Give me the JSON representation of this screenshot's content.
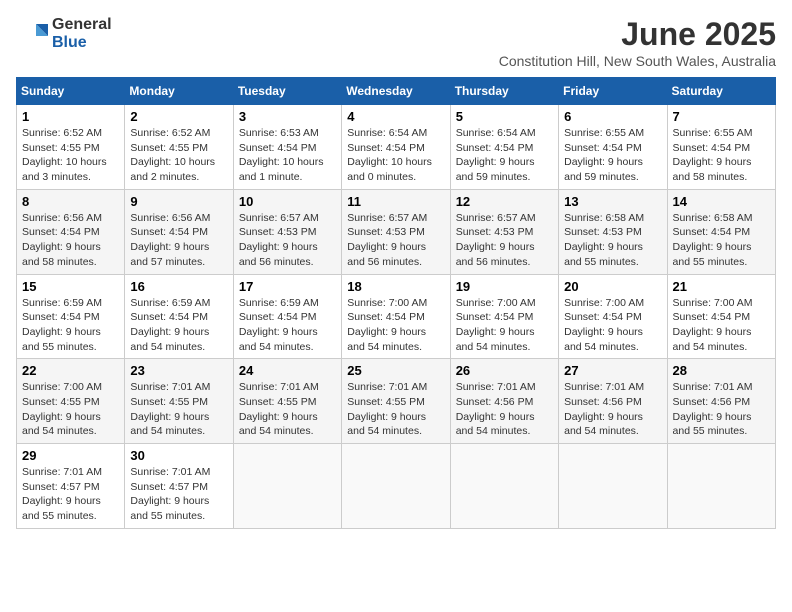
{
  "logo": {
    "general": "General",
    "blue": "Blue"
  },
  "title": "June 2025",
  "location": "Constitution Hill, New South Wales, Australia",
  "days_of_week": [
    "Sunday",
    "Monday",
    "Tuesday",
    "Wednesday",
    "Thursday",
    "Friday",
    "Saturday"
  ],
  "weeks": [
    [
      {
        "day": "1",
        "lines": [
          "Sunrise: 6:52 AM",
          "Sunset: 4:55 PM",
          "Daylight: 10 hours",
          "and 3 minutes."
        ]
      },
      {
        "day": "2",
        "lines": [
          "Sunrise: 6:52 AM",
          "Sunset: 4:55 PM",
          "Daylight: 10 hours",
          "and 2 minutes."
        ]
      },
      {
        "day": "3",
        "lines": [
          "Sunrise: 6:53 AM",
          "Sunset: 4:54 PM",
          "Daylight: 10 hours",
          "and 1 minute."
        ]
      },
      {
        "day": "4",
        "lines": [
          "Sunrise: 6:54 AM",
          "Sunset: 4:54 PM",
          "Daylight: 10 hours",
          "and 0 minutes."
        ]
      },
      {
        "day": "5",
        "lines": [
          "Sunrise: 6:54 AM",
          "Sunset: 4:54 PM",
          "Daylight: 9 hours",
          "and 59 minutes."
        ]
      },
      {
        "day": "6",
        "lines": [
          "Sunrise: 6:55 AM",
          "Sunset: 4:54 PM",
          "Daylight: 9 hours",
          "and 59 minutes."
        ]
      },
      {
        "day": "7",
        "lines": [
          "Sunrise: 6:55 AM",
          "Sunset: 4:54 PM",
          "Daylight: 9 hours",
          "and 58 minutes."
        ]
      }
    ],
    [
      {
        "day": "8",
        "lines": [
          "Sunrise: 6:56 AM",
          "Sunset: 4:54 PM",
          "Daylight: 9 hours",
          "and 58 minutes."
        ]
      },
      {
        "day": "9",
        "lines": [
          "Sunrise: 6:56 AM",
          "Sunset: 4:54 PM",
          "Daylight: 9 hours",
          "and 57 minutes."
        ]
      },
      {
        "day": "10",
        "lines": [
          "Sunrise: 6:57 AM",
          "Sunset: 4:53 PM",
          "Daylight: 9 hours",
          "and 56 minutes."
        ]
      },
      {
        "day": "11",
        "lines": [
          "Sunrise: 6:57 AM",
          "Sunset: 4:53 PM",
          "Daylight: 9 hours",
          "and 56 minutes."
        ]
      },
      {
        "day": "12",
        "lines": [
          "Sunrise: 6:57 AM",
          "Sunset: 4:53 PM",
          "Daylight: 9 hours",
          "and 56 minutes."
        ]
      },
      {
        "day": "13",
        "lines": [
          "Sunrise: 6:58 AM",
          "Sunset: 4:53 PM",
          "Daylight: 9 hours",
          "and 55 minutes."
        ]
      },
      {
        "day": "14",
        "lines": [
          "Sunrise: 6:58 AM",
          "Sunset: 4:54 PM",
          "Daylight: 9 hours",
          "and 55 minutes."
        ]
      }
    ],
    [
      {
        "day": "15",
        "lines": [
          "Sunrise: 6:59 AM",
          "Sunset: 4:54 PM",
          "Daylight: 9 hours",
          "and 55 minutes."
        ]
      },
      {
        "day": "16",
        "lines": [
          "Sunrise: 6:59 AM",
          "Sunset: 4:54 PM",
          "Daylight: 9 hours",
          "and 54 minutes."
        ]
      },
      {
        "day": "17",
        "lines": [
          "Sunrise: 6:59 AM",
          "Sunset: 4:54 PM",
          "Daylight: 9 hours",
          "and 54 minutes."
        ]
      },
      {
        "day": "18",
        "lines": [
          "Sunrise: 7:00 AM",
          "Sunset: 4:54 PM",
          "Daylight: 9 hours",
          "and 54 minutes."
        ]
      },
      {
        "day": "19",
        "lines": [
          "Sunrise: 7:00 AM",
          "Sunset: 4:54 PM",
          "Daylight: 9 hours",
          "and 54 minutes."
        ]
      },
      {
        "day": "20",
        "lines": [
          "Sunrise: 7:00 AM",
          "Sunset: 4:54 PM",
          "Daylight: 9 hours",
          "and 54 minutes."
        ]
      },
      {
        "day": "21",
        "lines": [
          "Sunrise: 7:00 AM",
          "Sunset: 4:54 PM",
          "Daylight: 9 hours",
          "and 54 minutes."
        ]
      }
    ],
    [
      {
        "day": "22",
        "lines": [
          "Sunrise: 7:00 AM",
          "Sunset: 4:55 PM",
          "Daylight: 9 hours",
          "and 54 minutes."
        ]
      },
      {
        "day": "23",
        "lines": [
          "Sunrise: 7:01 AM",
          "Sunset: 4:55 PM",
          "Daylight: 9 hours",
          "and 54 minutes."
        ]
      },
      {
        "day": "24",
        "lines": [
          "Sunrise: 7:01 AM",
          "Sunset: 4:55 PM",
          "Daylight: 9 hours",
          "and 54 minutes."
        ]
      },
      {
        "day": "25",
        "lines": [
          "Sunrise: 7:01 AM",
          "Sunset: 4:55 PM",
          "Daylight: 9 hours",
          "and 54 minutes."
        ]
      },
      {
        "day": "26",
        "lines": [
          "Sunrise: 7:01 AM",
          "Sunset: 4:56 PM",
          "Daylight: 9 hours",
          "and 54 minutes."
        ]
      },
      {
        "day": "27",
        "lines": [
          "Sunrise: 7:01 AM",
          "Sunset: 4:56 PM",
          "Daylight: 9 hours",
          "and 54 minutes."
        ]
      },
      {
        "day": "28",
        "lines": [
          "Sunrise: 7:01 AM",
          "Sunset: 4:56 PM",
          "Daylight: 9 hours",
          "and 55 minutes."
        ]
      }
    ],
    [
      {
        "day": "29",
        "lines": [
          "Sunrise: 7:01 AM",
          "Sunset: 4:57 PM",
          "Daylight: 9 hours",
          "and 55 minutes."
        ]
      },
      {
        "day": "30",
        "lines": [
          "Sunrise: 7:01 AM",
          "Sunset: 4:57 PM",
          "Daylight: 9 hours",
          "and 55 minutes."
        ]
      },
      null,
      null,
      null,
      null,
      null
    ]
  ]
}
